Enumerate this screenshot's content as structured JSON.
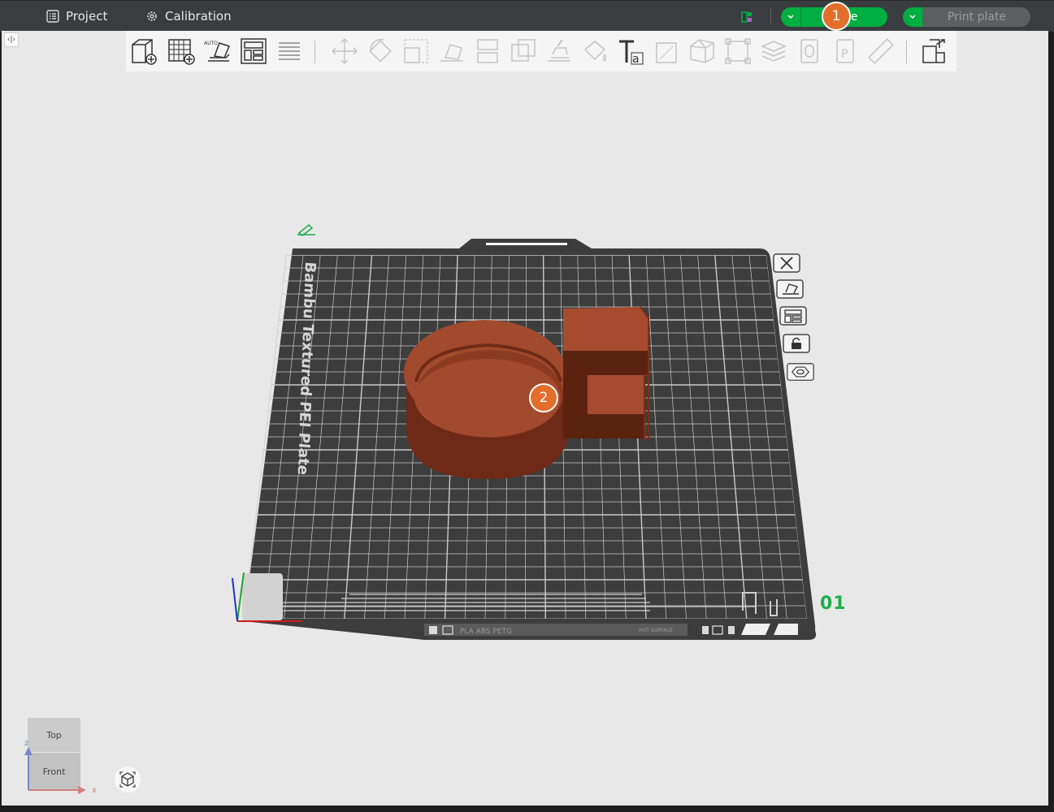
{
  "topbar": {
    "project_label": "Project",
    "calibration_label": "Calibration",
    "slice_label": "Slice plate",
    "print_label": "Print plate",
    "accent": "#00ae42"
  },
  "toolbar": {
    "tools": [
      {
        "name": "add-cube-icon",
        "enabled": true
      },
      {
        "name": "add-plate-icon",
        "enabled": true
      },
      {
        "name": "auto-orient-icon",
        "enabled": true
      },
      {
        "name": "arrange-icon",
        "enabled": true
      },
      {
        "name": "split-layers-icon",
        "enabled": true
      },
      {
        "name": "move-icon",
        "enabled": false
      },
      {
        "name": "rotate-icon",
        "enabled": false
      },
      {
        "name": "scale-icon",
        "enabled": false
      },
      {
        "name": "lay-on-face-icon",
        "enabled": false
      },
      {
        "name": "cut-icon",
        "enabled": false
      },
      {
        "name": "boolean-icon",
        "enabled": false
      },
      {
        "name": "support-paint-icon",
        "enabled": false
      },
      {
        "name": "color-paint-icon",
        "enabled": false
      },
      {
        "name": "text-icon",
        "enabled": true
      },
      {
        "name": "emboss-icon",
        "enabled": false
      },
      {
        "name": "simplify-icon",
        "enabled": false
      },
      {
        "name": "assembly-icon",
        "enabled": false
      },
      {
        "name": "variable-layer-icon",
        "enabled": false
      },
      {
        "name": "object-list-icon",
        "enabled": false
      },
      {
        "name": "parts-list-icon",
        "enabled": false
      },
      {
        "name": "measure-icon",
        "enabled": false
      },
      {
        "name": "assemble-view-icon",
        "enabled": true
      }
    ]
  },
  "plate": {
    "title": "Bambu Textured PEI Plate",
    "number": "01",
    "footer_text": "PLA ABS PETG",
    "footer_hot": "HOT SURFACE",
    "grid_color": "#c9c9c9",
    "plate_color": "#3d3d3d",
    "model_color": "#a14a2e"
  },
  "plate_buttons": [
    "delete-plate-icon",
    "orient-plate-icon",
    "arrange-plate-icon",
    "lock-plate-icon",
    "plate-settings-icon"
  ],
  "callouts": [
    "1",
    "2"
  ],
  "view_cube": {
    "top_label": "Top",
    "front_label": "Front",
    "x_label": "x",
    "z_label": "z"
  }
}
